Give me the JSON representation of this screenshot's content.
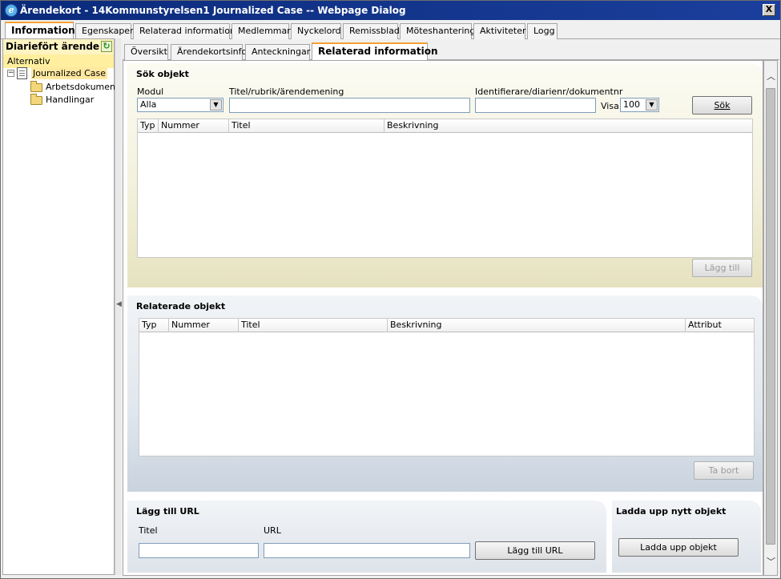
{
  "window": {
    "title": "Ärendekort - 14Kommunstyrelsen1 Journalized Case -- Webpage Dialog",
    "close_label": "X"
  },
  "top_tabs": [
    "Information",
    "Egenskaper",
    "Relaterad information",
    "Medlemmar",
    "Nyckelord",
    "Remissblad",
    "Möteshantering",
    "Aktiviteter",
    "Logg"
  ],
  "sidebar": {
    "header": "Diariefört ärende",
    "alternativ": "Alternativ",
    "tree": {
      "root": "Journalized Case",
      "children": [
        "Arbetsdokument",
        "Handlingar"
      ]
    }
  },
  "sub_tabs": [
    "Översikt",
    "Ärendekortsinfo",
    "Anteckningar",
    "Relaterad information"
  ],
  "search_panel": {
    "title": "Sök objekt",
    "modul_label": "Modul",
    "modul_value": "Alla",
    "title_label": "Titel/rubrik/ärendemening",
    "title_value": "",
    "ident_label": "Identifierare/diarienr/dokumentnr",
    "ident_value": "",
    "visa_label": "Visa",
    "visa_value": "100",
    "search_button": "Sök",
    "columns": [
      "Typ",
      "Nummer",
      "Titel",
      "Beskrivning"
    ],
    "add_button": "Lägg till"
  },
  "related_panel": {
    "title": "Relaterade objekt",
    "columns": [
      "Typ",
      "Nummer",
      "Titel",
      "Beskrivning",
      "Attribut"
    ],
    "remove_button": "Ta bort"
  },
  "url_panel": {
    "title": "Lägg till URL",
    "titel_label": "Titel",
    "url_label": "URL",
    "titel_value": "",
    "url_value": "",
    "button": "Lägg till URL"
  },
  "upload_panel": {
    "title": "Ladda upp nytt objekt",
    "button": "Ladda upp objekt"
  }
}
